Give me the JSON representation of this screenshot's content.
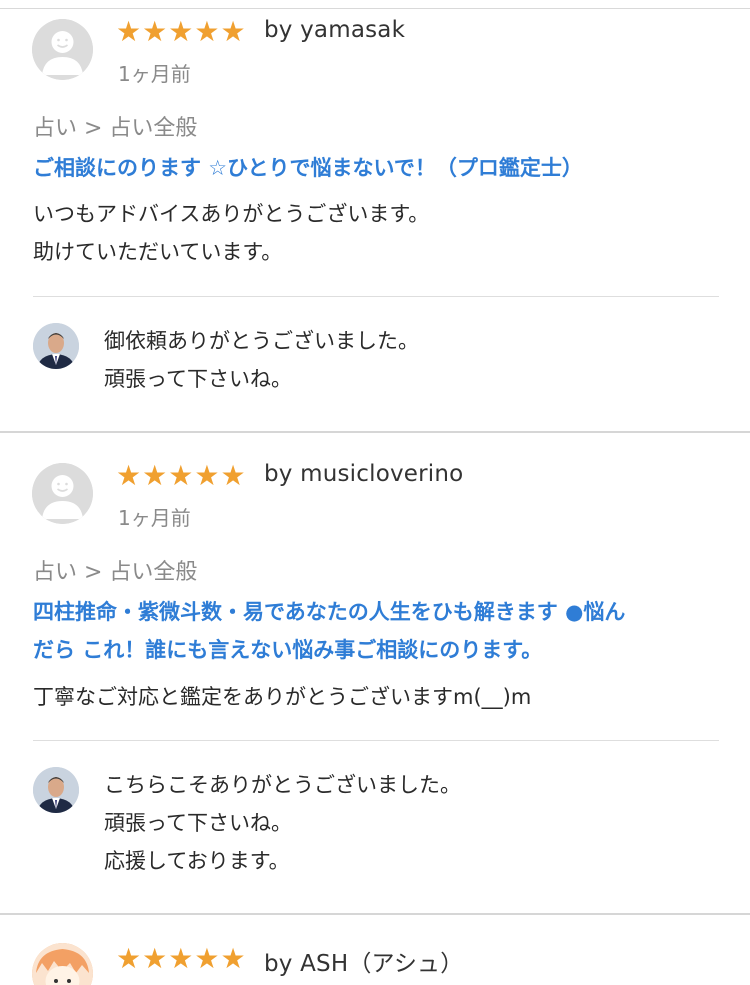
{
  "colors": {
    "star": "#f0a030",
    "service_link": "#2f7dd6",
    "muted": "#8a8a8a"
  },
  "reviews": [
    {
      "rating": 5,
      "reviewer": "by yamasak",
      "date": "1ヶ月前",
      "category": "占い > 占い全般",
      "service_title": "ご相談にのります ☆ひとりで悩まないで！（プロ鑑定士）",
      "comment_lines": [
        "いつもアドバイスありがとうございます。",
        "助けていただいています。"
      ],
      "reply_lines": [
        "御依頼ありがとうございました。",
        "頑張って下さいね。"
      ]
    },
    {
      "rating": 5,
      "reviewer": "by musicloverino",
      "date": "1ヶ月前",
      "category": "占い > 占い全般",
      "service_title_lines": [
        "四柱推命・紫微斗数・易であなたの人生をひも解きます ●悩ん",
        "だら これ！誰にも言えない悩み事ご相談にのります。"
      ],
      "comment_lines": [
        "丁寧なご対応と鑑定をありがとうございますm(__)m"
      ],
      "reply_lines": [
        "こちらこそありがとうございました。",
        "頑張って下さいね。",
        "応援しております。"
      ]
    },
    {
      "rating": 5,
      "reviewer": "by ASH（アシュ）"
    }
  ],
  "icons": {
    "star": "star-icon",
    "default_avatar": "default-avatar-icon",
    "seller_avatar": "seller-avatar-photo"
  }
}
